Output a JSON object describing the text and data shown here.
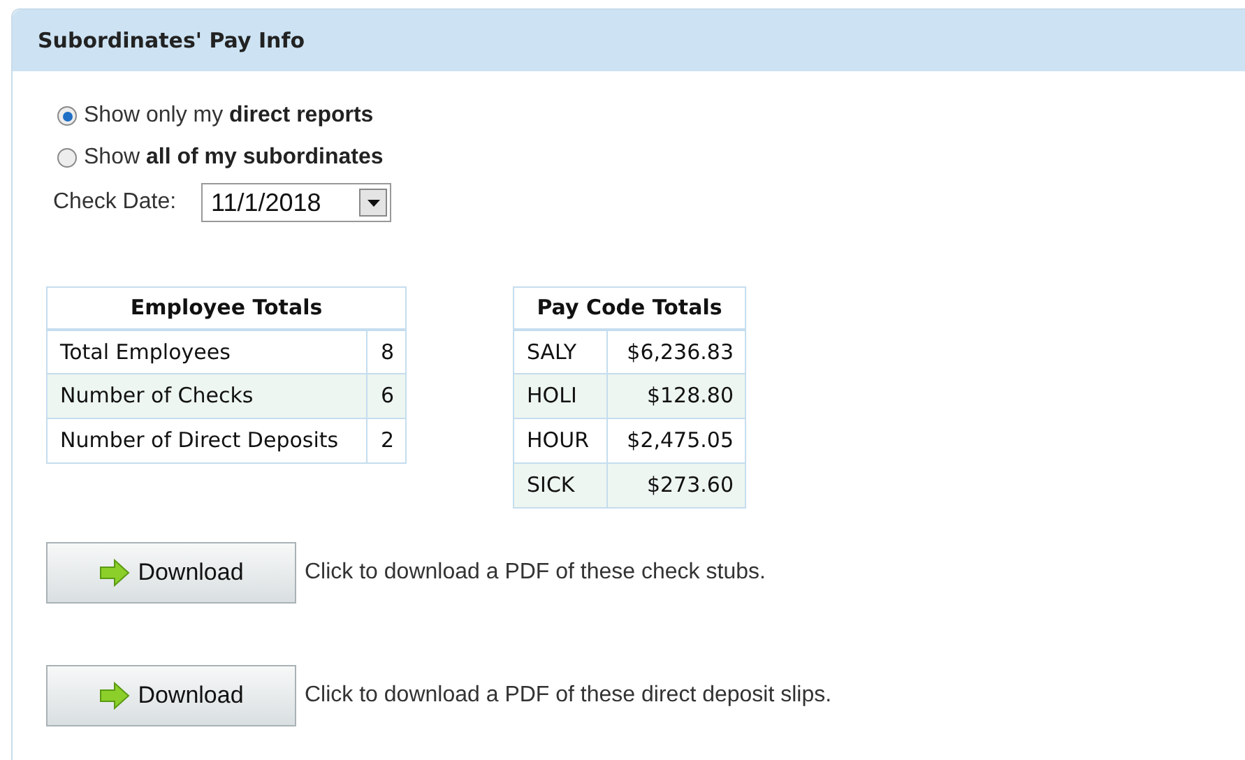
{
  "panel": {
    "title": "Subordinates' Pay Info"
  },
  "scope_options": [
    {
      "label": "Show only my **direct reports**",
      "selected": true
    },
    {
      "label": "Show **all of my subordinates**",
      "selected": false
    }
  ],
  "check_date": {
    "label": "Check Date:",
    "value": "11/1/2018"
  },
  "employee_totals": {
    "title": "Employee Totals",
    "rows": [
      {
        "label": "Total Employees",
        "value": "8"
      },
      {
        "label": "Number of Checks",
        "value": "6"
      },
      {
        "label": "Number of Direct Deposits",
        "value": "2"
      }
    ]
  },
  "pay_code_totals": {
    "title": "Pay Code Totals",
    "rows": [
      {
        "code": "SALY",
        "amount": "$6,236.83"
      },
      {
        "code": "HOLI",
        "amount": "$128.80"
      },
      {
        "code": "HOUR",
        "amount": "$2,475.05"
      },
      {
        "code": "SICK",
        "amount": "$273.60"
      }
    ]
  },
  "downloads": [
    {
      "button": "Download",
      "description": "Click to download a PDF of these check stubs."
    },
    {
      "button": "Download",
      "description": "Click to download a PDF of these direct deposit slips."
    }
  ]
}
